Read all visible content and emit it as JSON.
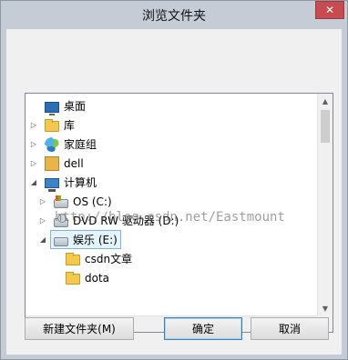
{
  "window": {
    "title": "浏览文件夹",
    "close_glyph": "✕"
  },
  "tree": {
    "items": [
      {
        "label": "桌面",
        "expander": "",
        "icon": "desktop-icon"
      },
      {
        "label": "库",
        "expander": "▷",
        "icon": "folder-icon"
      },
      {
        "label": "家庭组",
        "expander": "▷",
        "icon": "homegroup-icon"
      },
      {
        "label": "dell",
        "expander": "▷",
        "icon": "user-folder-icon"
      },
      {
        "label": "计算机",
        "expander": "◢",
        "icon": "computer-icon"
      },
      {
        "label": "OS (C:)",
        "expander": "▷",
        "icon": "windows-drive-icon"
      },
      {
        "label": "DVD RW 驱动器 (D:)",
        "expander": "▷",
        "icon": "dvd-drive-icon"
      },
      {
        "label": "娱乐 (E:)",
        "expander": "◢",
        "icon": "drive-icon",
        "selected": true
      },
      {
        "label": "csdn文章",
        "expander": "",
        "icon": "folder-icon"
      },
      {
        "label": "dota",
        "expander": "",
        "icon": "folder-icon"
      }
    ],
    "scroll_up": "▲",
    "scroll_down": "▼",
    "scroll_left": "◀",
    "scroll_right": "▶"
  },
  "watermark": "http://blog.csdn.net/Eastmount",
  "buttons": {
    "new_folder": "新建文件夹(M)",
    "ok": "确定",
    "cancel": "取消"
  }
}
